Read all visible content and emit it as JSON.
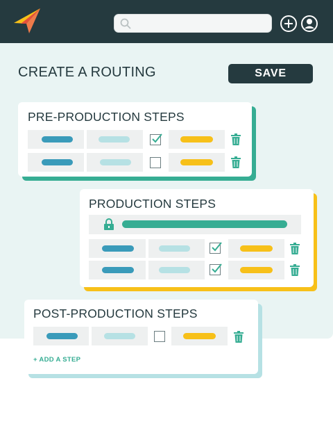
{
  "header": {
    "search": {
      "placeholder": ""
    }
  },
  "page": {
    "title": "CREATE A ROUTING",
    "save_label": "SAVE"
  },
  "colors": {
    "dark": "#253a3f",
    "teal": "#36ad93",
    "yellow": "#f7c019",
    "blue": "#3a9bba",
    "light_blue": "#b6e1e4",
    "background": "#e9f4f3"
  },
  "sections": [
    {
      "title": "PRE-PRODUCTION STEPS",
      "accent": "#36ad93",
      "steps": [
        {
          "checked": true
        },
        {
          "checked": false
        }
      ]
    },
    {
      "title": "PRODUCTION STEPS",
      "accent": "#f7c019",
      "locked_step": true,
      "steps": [
        {
          "checked": true
        },
        {
          "checked": true
        }
      ]
    },
    {
      "title": "POST-PRODUCTION STEPS",
      "accent": "#b6e1e4",
      "steps": [
        {
          "checked": false
        }
      ],
      "add_step_label": "+ ADD A STEP"
    }
  ]
}
